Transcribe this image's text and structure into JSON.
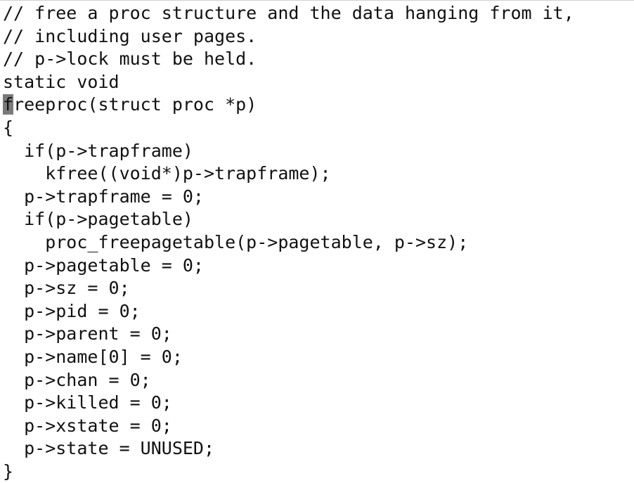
{
  "editor": {
    "cursor_char": "f",
    "lines": [
      "// free a proc structure and the data hanging from it,",
      "// including user pages.",
      "// p->lock must be held.",
      "static void",
      "reeproc(struct proc *p)",
      "{",
      "  if(p->trapframe)",
      "    kfree((void*)p->trapframe);",
      "  p->trapframe = 0;",
      "  if(p->pagetable)",
      "    proc_freepagetable(p->pagetable, p->sz);",
      "  p->pagetable = 0;",
      "  p->sz = 0;",
      "  p->pid = 0;",
      "  p->parent = 0;",
      "  p->name[0] = 0;",
      "  p->chan = 0;",
      "  p->killed = 0;",
      "  p->xstate = 0;",
      "  p->state = UNUSED;",
      "}"
    ]
  }
}
